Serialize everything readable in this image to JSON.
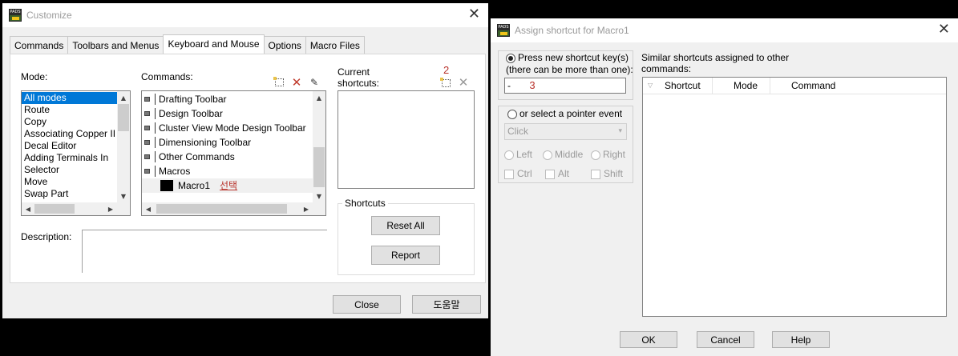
{
  "customize": {
    "title": "Customize",
    "tabs": [
      "Commands",
      "Toolbars and Menus",
      "Keyboard and Mouse",
      "Options",
      "Macro Files"
    ],
    "mode_label": "Mode:",
    "modes": [
      "All modes",
      "Route",
      "Copy",
      "Associating Copper II",
      "Decal Editor",
      "Adding Terminals In",
      "Selector",
      "Move",
      "Swap Part"
    ],
    "commands_label": "Commands:",
    "commands": [
      "Drafting Toolbar",
      "Design Toolbar",
      "Cluster View Mode Design Toolbar",
      "Dimensioning Toolbar",
      "Other Commands",
      "Macros"
    ],
    "macro_item": "Macro1",
    "macro_note": "선택",
    "current_shortcuts_label": "Current\nshortcuts:",
    "step_marker": "2",
    "shortcuts_group": "Shortcuts",
    "reset_all": "Reset All",
    "report": "Report",
    "description_label": "Description:",
    "close": "Close",
    "help": "도움말"
  },
  "assign": {
    "title": "Assign shortcut for Macro1",
    "press_label_1": "Press new shortcut key(s)",
    "press_label_2": "(there can be more than one):",
    "shortcut_value": "-",
    "step_marker": "3",
    "pointer_label": "or select a pointer event",
    "pointer_select": "Click",
    "left": "Left",
    "middle": "Middle",
    "right": "Right",
    "ctrl": "Ctrl",
    "alt": "Alt",
    "shift": "Shift",
    "similar_label_1": "Similar shortcuts assigned to other",
    "similar_label_2": "commands:",
    "columns": [
      "Shortcut",
      "Mode",
      "Command"
    ],
    "ok": "OK",
    "cancel": "Cancel",
    "help": "Help"
  },
  "colors": {
    "selection": "#0078d7",
    "annotation": "#b8322b"
  }
}
